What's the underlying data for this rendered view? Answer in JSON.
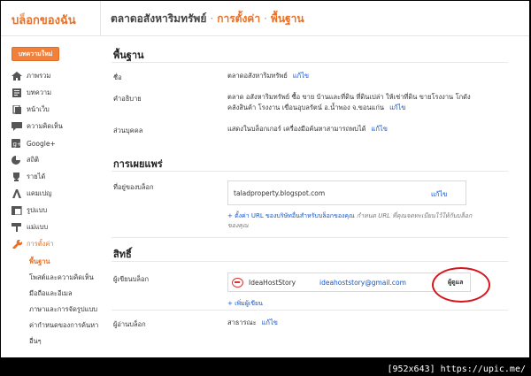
{
  "header": {
    "brand": "บล็อกของฉัน",
    "breadcrumb": [
      "ตลาดอสังหาริมทรัพย์",
      "การตั้งค่า",
      "พื้นฐาน"
    ],
    "separator": "·"
  },
  "sidebar": {
    "new_post": "บทความใหม่",
    "items": [
      {
        "label": "ภาพรวม",
        "icon": "home-icon"
      },
      {
        "label": "บทความ",
        "icon": "posts-icon"
      },
      {
        "label": "หน้าเว็บ",
        "icon": "pages-icon"
      },
      {
        "label": "ความคิดเห็น",
        "icon": "comments-icon"
      },
      {
        "label": "Google+",
        "icon": "google-plus-icon"
      },
      {
        "label": "สถิติ",
        "icon": "stats-icon"
      },
      {
        "label": "รายได้",
        "icon": "trophy-icon"
      },
      {
        "label": "แคมเปญ",
        "icon": "campaign-icon"
      },
      {
        "label": "รูปแบบ",
        "icon": "layout-icon"
      },
      {
        "label": "แม่แบบ",
        "icon": "template-icon"
      },
      {
        "label": "การตั้งค่า",
        "icon": "wrench-icon"
      }
    ],
    "subitems": [
      "พื้นฐาน",
      "โพสต์และความคิดเห็น",
      "มือถือและอีเมล",
      "ภาษาและการจัดรูปแบบ",
      "ค่ากำหนดของการค้นหา",
      "อื่นๆ"
    ]
  },
  "basics": {
    "title": "พื้นฐาน",
    "name_label": "ชื่อ",
    "name_value": "ตลาดอสังหาริมทรัพย์",
    "desc_label": "คำอธิบาย",
    "desc_line1": "ตลาด อสังหาริมทรัพย์ ซื้อ ขาย บ้านและที่ดิน ที่ดินเปล่า ให้เช่าที่ดิน ขายโรงงาน โกดัง",
    "desc_line2": "คลังสินค้า โรงงาน เขื่อนอุบลรัตน์ อ.น้ำพอง จ.ขอนแก่น",
    "privacy_label": "ส่วนบุคคล",
    "privacy_value": "แสดงในบล็อกเกอร์ เครื่องมือค้นหาสามารถพบได้",
    "edit": "แก้ไข"
  },
  "publishing": {
    "title": "การเผยแพร่",
    "address_label": "ที่อยู่ของบล็อก",
    "address_value": "taladproperty.blogspot.com",
    "edit": "แก้ไข",
    "hint_link": "+ ตั้งค่า URL ของบริษัทอื่นสำหรับบล็อกของคุณ",
    "hint_rest": "กำหนด URL ที่คุณจดทะเบียนไว้ให้กับบล็อก",
    "hint_line2": "ของคุณ"
  },
  "permissions": {
    "title": "สิทธิ์",
    "authors_label": "ผู้เขียนบล็อก",
    "author_name": "IdeaHostStory",
    "author_email": "ideahoststory@gmail.com",
    "author_role": "ผู้ดูแล",
    "add_author": "+ เพิ่มผู้เขียน",
    "readers_label": "ผู้อ่านบล็อก",
    "readers_value": "สาธารณะ",
    "edit": "แก้ไข"
  },
  "footer": "[952x643] https://upic.me/"
}
